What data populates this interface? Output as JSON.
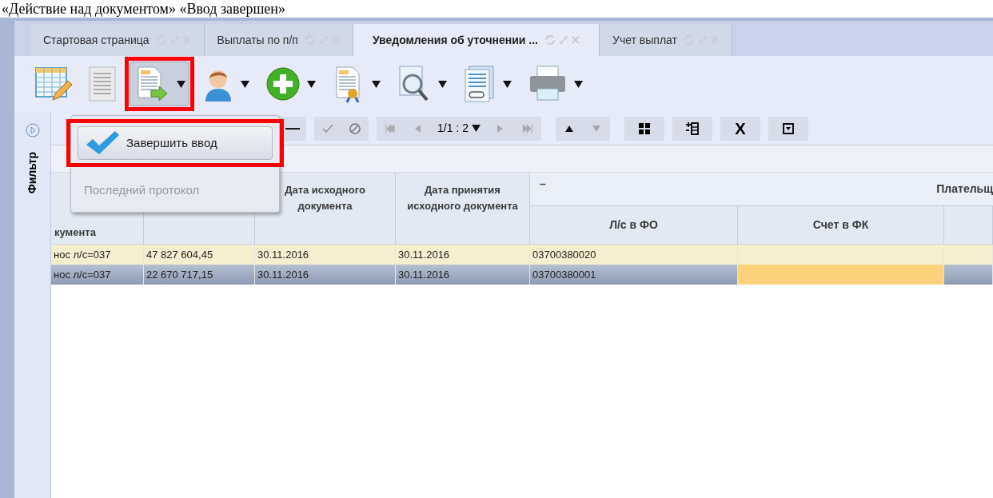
{
  "caption": "«Действие над документом» «Ввод завершен»",
  "tabs": [
    {
      "label": "Стартовая страница",
      "selected": false
    },
    {
      "label": "Выплаты по п/п",
      "selected": false
    },
    {
      "label": "Уведомления об уточнении ...",
      "selected": true
    },
    {
      "label": "Учет выплат",
      "selected": false
    }
  ],
  "toolbar": [
    {
      "kind": "table-edit",
      "dropdown": false,
      "pressed": false,
      "highlighted": false
    },
    {
      "kind": "list",
      "dropdown": false,
      "pressed": false,
      "highlighted": false
    },
    {
      "kind": "doc-arrow",
      "dropdown": true,
      "pressed": true,
      "highlighted": true
    },
    {
      "kind": "user",
      "dropdown": true,
      "pressed": false,
      "highlighted": false
    },
    {
      "kind": "add",
      "dropdown": true,
      "pressed": false,
      "highlighted": false
    },
    {
      "kind": "doc-seal",
      "dropdown": true,
      "pressed": false,
      "highlighted": false
    },
    {
      "kind": "doc-search",
      "dropdown": true,
      "pressed": false,
      "highlighted": false
    },
    {
      "kind": "doc-link",
      "dropdown": true,
      "pressed": false,
      "highlighted": false
    },
    {
      "kind": "printer",
      "dropdown": true,
      "pressed": false,
      "highlighted": false
    }
  ],
  "nav": {
    "minus": "—",
    "pager": "1/1 : 2",
    "clear": "X"
  },
  "side_panel": {
    "label": "Фильтр"
  },
  "menu": [
    {
      "kind": "check",
      "label": "Завершить ввод",
      "disabled": false,
      "highlighted": true
    },
    {
      "kind": "plain",
      "label": "Последний протокол",
      "disabled": true,
      "highlighted": false
    }
  ],
  "table": {
    "group_header": {
      "marker": "–",
      "label": "Плательщ"
    },
    "columns": [
      {
        "label": "кумента"
      },
      {},
      {
        "label": "Дата исходного документа"
      },
      {
        "label": "Дата принятия исходного документа"
      },
      {
        "label": "Л/с в ФО"
      },
      {
        "label": "Счет в ФК"
      },
      {}
    ],
    "rows": [
      {
        "selected": false,
        "cells": [
          {
            "text": "нос л/с=037",
            "focused": false
          },
          {
            "text": "47 827 604,45",
            "focused": false
          },
          {
            "text": "30.11.2016",
            "focused": false
          },
          {
            "text": "30.11.2016",
            "focused": false
          },
          {
            "text": "03700380020",
            "focused": false
          },
          {
            "focused": false
          },
          {
            "focused": false
          }
        ]
      },
      {
        "selected": true,
        "cells": [
          {
            "text": "нос л/с=037",
            "focused": false
          },
          {
            "text": "22 670 717,15",
            "focused": false
          },
          {
            "text": "30.11.2016",
            "focused": false
          },
          {
            "text": "30.11.2016",
            "focused": false
          },
          {
            "text": "03700380001",
            "focused": false
          },
          {
            "focused": true
          },
          {
            "focused": false
          }
        ]
      }
    ]
  }
}
